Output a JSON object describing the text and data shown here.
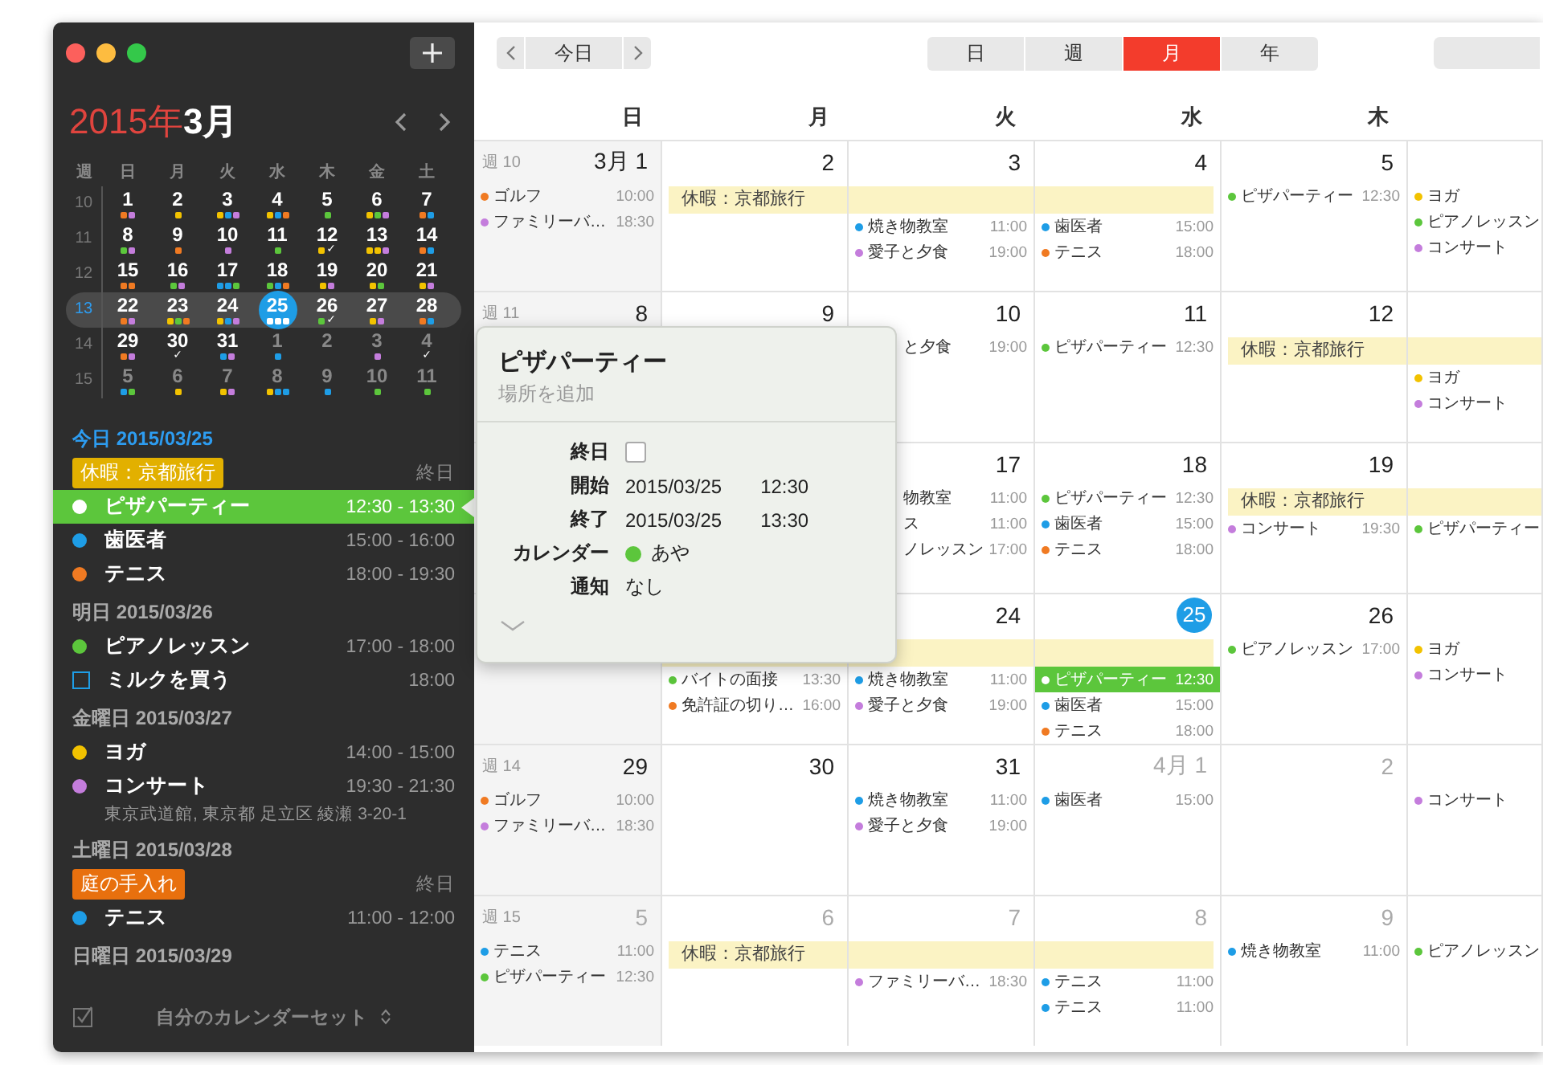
{
  "sidebar": {
    "mini": {
      "year": "2015年",
      "month": "3月",
      "weekdays": [
        "週",
        "日",
        "月",
        "火",
        "水",
        "木",
        "金",
        "土"
      ],
      "weeks": [
        {
          "week": "10",
          "current": false,
          "days": [
            {
              "n": "1",
              "other": false,
              "today": false,
              "dots": [
                {
                  "color": "#f07a22"
                },
                {
                  "color": "#c47ddc"
                }
              ]
            },
            {
              "n": "2",
              "other": false,
              "today": false,
              "dots": [
                {
                  "color": "#f2c200"
                }
              ]
            },
            {
              "n": "3",
              "other": false,
              "today": false,
              "dots": [
                {
                  "color": "#f2c200"
                },
                {
                  "color": "#1e9de6"
                },
                {
                  "color": "#c47ddc"
                }
              ]
            },
            {
              "n": "4",
              "other": false,
              "today": false,
              "dots": [
                {
                  "color": "#f2c200"
                },
                {
                  "color": "#1e9de6"
                },
                {
                  "color": "#f07a22"
                }
              ]
            },
            {
              "n": "5",
              "other": false,
              "today": false,
              "dots": [
                {
                  "color": "#5cc63c"
                }
              ]
            },
            {
              "n": "6",
              "other": false,
              "today": false,
              "dots": [
                {
                  "color": "#f2c200"
                },
                {
                  "color": "#5cc63c"
                },
                {
                  "color": "#c47ddc"
                }
              ]
            },
            {
              "n": "7",
              "other": false,
              "today": false,
              "dots": [
                {
                  "color": "#f07a22"
                },
                {
                  "color": "#1e9de6"
                }
              ]
            }
          ]
        },
        {
          "week": "11",
          "current": false,
          "days": [
            {
              "n": "8",
              "other": false,
              "today": false,
              "dots": [
                {
                  "color": "#5cc63c"
                },
                {
                  "color": "#c47ddc"
                }
              ]
            },
            {
              "n": "9",
              "other": false,
              "today": false,
              "dots": [
                {
                  "color": "#f07a22"
                }
              ]
            },
            {
              "n": "10",
              "other": false,
              "today": false,
              "dots": [
                {
                  "color": "#c47ddc"
                }
              ]
            },
            {
              "n": "11",
              "other": false,
              "today": false,
              "dots": [
                {
                  "color": "#5cc63c"
                }
              ]
            },
            {
              "n": "12",
              "other": false,
              "today": false,
              "dots": [
                {
                  "color": "#f2c200"
                }
              ],
              "mark": "✓"
            },
            {
              "n": "13",
              "other": false,
              "today": false,
              "dots": [
                {
                  "color": "#f2c200"
                },
                {
                  "color": "#f2c200"
                },
                {
                  "color": "#c47ddc"
                }
              ]
            },
            {
              "n": "14",
              "other": false,
              "today": false,
              "dots": [
                {
                  "color": "#f07a22"
                },
                {
                  "color": "#1e9de6"
                }
              ]
            }
          ]
        },
        {
          "week": "12",
          "current": false,
          "days": [
            {
              "n": "15",
              "other": false,
              "today": false,
              "dots": [
                {
                  "color": "#f07a22"
                },
                {
                  "color": "#f07a22"
                }
              ]
            },
            {
              "n": "16",
              "other": false,
              "today": false,
              "dots": [
                {
                  "color": "#5cc63c"
                },
                {
                  "color": "#c47ddc"
                }
              ]
            },
            {
              "n": "17",
              "other": false,
              "today": false,
              "dots": [
                {
                  "color": "#1e9de6"
                },
                {
                  "color": "#1e9de6"
                },
                {
                  "color": "#5cc63c"
                }
              ]
            },
            {
              "n": "18",
              "other": false,
              "today": false,
              "dots": [
                {
                  "color": "#5cc63c"
                },
                {
                  "color": "#1e9de6"
                },
                {
                  "color": "#f07a22"
                }
              ]
            },
            {
              "n": "19",
              "other": false,
              "today": false,
              "dots": [
                {
                  "color": "#f2c200"
                },
                {
                  "color": "#c47ddc"
                }
              ]
            },
            {
              "n": "20",
              "other": false,
              "today": false,
              "dots": [
                {
                  "color": "#f2c200"
                },
                {
                  "color": "#5cc63c"
                }
              ]
            },
            {
              "n": "21",
              "other": false,
              "today": false,
              "dots": [
                {
                  "color": "#f2c200"
                },
                {
                  "color": "#c47ddc"
                }
              ]
            }
          ]
        },
        {
          "week": "13",
          "current": true,
          "days": [
            {
              "n": "22",
              "other": false,
              "today": false,
              "dots": [
                {
                  "color": "#f07a22"
                },
                {
                  "color": "#c47ddc"
                }
              ]
            },
            {
              "n": "23",
              "other": false,
              "today": false,
              "dots": [
                {
                  "color": "#f2c200"
                },
                {
                  "color": "#5cc63c"
                },
                {
                  "color": "#f07a22"
                }
              ]
            },
            {
              "n": "24",
              "other": false,
              "today": false,
              "dots": [
                {
                  "color": "#f2c200"
                },
                {
                  "color": "#1e9de6"
                },
                {
                  "color": "#c47ddc"
                }
              ]
            },
            {
              "n": "25",
              "other": false,
              "today": true,
              "dots": [
                {
                  "color": "#ffffff"
                },
                {
                  "color": "#ffffff"
                },
                {
                  "color": "#ffffff"
                }
              ]
            },
            {
              "n": "26",
              "other": false,
              "today": false,
              "dots": [
                {
                  "color": "#5cc63c"
                }
              ],
              "mark": "✓"
            },
            {
              "n": "27",
              "other": false,
              "today": false,
              "dots": [
                {
                  "color": "#f2c200"
                },
                {
                  "color": "#c47ddc"
                }
              ]
            },
            {
              "n": "28",
              "other": false,
              "today": false,
              "dots": [
                {
                  "color": "#f07a22"
                },
                {
                  "color": "#1e9de6"
                }
              ]
            }
          ]
        },
        {
          "week": "14",
          "current": false,
          "days": [
            {
              "n": "29",
              "other": false,
              "today": false,
              "dots": [
                {
                  "color": "#f07a22"
                },
                {
                  "color": "#c47ddc"
                }
              ]
            },
            {
              "n": "30",
              "other": false,
              "today": false,
              "mark": "✓"
            },
            {
              "n": "31",
              "other": false,
              "today": false,
              "dots": [
                {
                  "color": "#1e9de6"
                },
                {
                  "color": "#c47ddc"
                }
              ]
            },
            {
              "n": "1",
              "other": true,
              "today": false,
              "dots": [
                {
                  "color": "#1e9de6"
                }
              ]
            },
            {
              "n": "2",
              "other": true,
              "today": false
            },
            {
              "n": "3",
              "other": true,
              "today": false,
              "dots": [
                {
                  "color": "#c47ddc"
                }
              ]
            },
            {
              "n": "4",
              "other": true,
              "today": false,
              "mark": "✓"
            }
          ]
        },
        {
          "week": "15",
          "current": false,
          "days": [
            {
              "n": "5",
              "other": true,
              "today": false,
              "dots": [
                {
                  "color": "#1e9de6"
                },
                {
                  "color": "#5cc63c"
                }
              ]
            },
            {
              "n": "6",
              "other": true,
              "today": false,
              "dots": [
                {
                  "color": "#f2c200"
                }
              ]
            },
            {
              "n": "7",
              "other": true,
              "today": false,
              "dots": [
                {
                  "color": "#f2c200"
                },
                {
                  "color": "#c47ddc"
                }
              ]
            },
            {
              "n": "8",
              "other": true,
              "today": false,
              "dots": [
                {
                  "color": "#f2c200"
                },
                {
                  "color": "#1e9de6"
                },
                {
                  "color": "#1e9de6"
                }
              ]
            },
            {
              "n": "9",
              "other": true,
              "today": false,
              "dots": [
                {
                  "color": "#1e9de6"
                }
              ]
            },
            {
              "n": "10",
              "other": true,
              "today": false,
              "dots": [
                {
                  "color": "#5cc63c"
                }
              ]
            },
            {
              "n": "11",
              "other": true,
              "today": false,
              "dots": [
                {
                  "color": "#5cc63c"
                }
              ]
            }
          ]
        }
      ]
    },
    "agenda": [
      {
        "heading": "今日 2015/03/25",
        "today": true,
        "items": [
          {
            "kind": "allday",
            "title": "休暇：京都旅行",
            "time": "終日",
            "color": "#e2b000",
            "selected": false
          },
          {
            "kind": "event",
            "title": "ピザパーティー",
            "time": "12:30 - 13:30",
            "color": "#5cc63c",
            "selected": true
          },
          {
            "kind": "event",
            "title": "歯医者",
            "time": "15:00 - 16:00",
            "color": "#1e9de6",
            "selected": false
          },
          {
            "kind": "event",
            "title": "テニス",
            "time": "18:00 - 19:30",
            "color": "#f07a22",
            "selected": false
          }
        ]
      },
      {
        "heading": "明日 2015/03/26",
        "today": false,
        "items": [
          {
            "kind": "event",
            "title": "ピアノレッスン",
            "time": "17:00 - 18:00",
            "color": "#5cc63c",
            "selected": false
          },
          {
            "kind": "task",
            "title": "ミルクを買う",
            "time": "18:00",
            "color": "#1e9de6",
            "selected": false
          }
        ]
      },
      {
        "heading": "金曜日 2015/03/27",
        "today": false,
        "items": [
          {
            "kind": "event",
            "title": "ヨガ",
            "time": "14:00 - 15:00",
            "color": "#f2c200",
            "selected": false
          },
          {
            "kind": "event",
            "title": "コンサート",
            "time": "19:30 - 21:30",
            "color": "#c47ddc",
            "selected": false,
            "location": "東京武道館, 東京都 足立区 綾瀬 3-20-1"
          }
        ]
      },
      {
        "heading": "土曜日 2015/03/28",
        "today": false,
        "items": [
          {
            "kind": "allday",
            "title": "庭の手入れ",
            "time": "終日",
            "color": "#e8700e",
            "selected": false
          },
          {
            "kind": "event",
            "title": "テニス",
            "time": "11:00 - 12:00",
            "color": "#1e9de6",
            "selected": false
          }
        ]
      },
      {
        "heading": "日曜日 2015/03/29",
        "today": false
      }
    ],
    "footer": {
      "label": "自分のカレンダーセット"
    }
  },
  "toolbar": {
    "today": "今日",
    "views": [
      {
        "label": "日",
        "selected": false
      },
      {
        "label": "週",
        "selected": false
      },
      {
        "label": "月",
        "selected": true
      },
      {
        "label": "年",
        "selected": false
      }
    ]
  },
  "calendar": {
    "weekdays": [
      "日",
      "月",
      "火",
      "水",
      "木"
    ],
    "weeks": [
      {
        "label": "週 10",
        "days": [
          {
            "date": "3月 1",
            "other": false,
            "today": false,
            "events": [
              {
                "kind": "event",
                "name": "ゴルフ",
                "time": "10:00",
                "color": "#f07a22",
                "selected": false
              },
              {
                "kind": "event",
                "name": "ファミリーバ…",
                "time": "18:30",
                "color": "#c47ddc",
                "selected": false
              }
            ]
          },
          {
            "date": "2",
            "other": false,
            "today": false,
            "allday": {
              "kind": "start",
              "title": "休暇：京都旅行"
            }
          },
          {
            "date": "3",
            "other": false,
            "today": false,
            "allday": {
              "kind": "middle"
            },
            "events": [
              {
                "kind": "event",
                "name": "焼き物教室",
                "time": "11:00",
                "color": "#1e9de6",
                "selected": false
              },
              {
                "kind": "event",
                "name": "愛子と夕食",
                "time": "19:00",
                "color": "#c47ddc",
                "selected": false
              }
            ]
          },
          {
            "date": "4",
            "other": false,
            "today": false,
            "allday": {
              "kind": "end"
            },
            "events": [
              {
                "kind": "event",
                "name": "歯医者",
                "time": "15:00",
                "color": "#1e9de6",
                "selected": false
              },
              {
                "kind": "event",
                "name": "テニス",
                "time": "18:00",
                "color": "#f07a22",
                "selected": false
              }
            ]
          },
          {
            "date": "5",
            "other": false,
            "today": false,
            "events": [
              {
                "kind": "event",
                "name": "ピザパーティー",
                "time": "12:30",
                "color": "#5cc63c",
                "selected": false
              }
            ]
          },
          {
            "events": [
              {
                "kind": "event",
                "name": "ヨガ",
                "color": "#f2c200",
                "selected": false
              },
              {
                "kind": "event",
                "name": "ピアノレッスン",
                "color": "#5cc63c",
                "selected": false
              },
              {
                "kind": "event",
                "name": "コンサート",
                "color": "#c47ddc",
                "selected": false
              }
            ]
          }
        ]
      },
      {
        "label": "週 11",
        "days": [
          {
            "date": "8",
            "other": false,
            "today": false
          },
          {
            "date": "9",
            "other": false,
            "today": false
          },
          {
            "date": "10",
            "other": false,
            "today": false,
            "events": [
              {
                "kind": "clipped",
                "name": "と夕食",
                "time": "19:00",
                "selected": false
              }
            ]
          },
          {
            "date": "11",
            "other": false,
            "today": false,
            "events": [
              {
                "kind": "event",
                "name": "ピザパーティー",
                "time": "12:30",
                "color": "#5cc63c",
                "selected": false
              }
            ]
          },
          {
            "date": "12",
            "other": false,
            "today": false,
            "allday": {
              "kind": "start",
              "title": "休暇：京都旅行"
            }
          },
          {
            "allday": {
              "kind": "middle"
            },
            "events": [
              {
                "kind": "event",
                "name": "ヨガ",
                "color": "#f2c200",
                "selected": false
              },
              {
                "kind": "event",
                "name": "コンサート",
                "color": "#c47ddc",
                "selected": false
              }
            ]
          }
        ]
      },
      {
        "days": [
          {
            "date": "17",
            "other": false,
            "today": false,
            "events": [
              {
                "kind": "clipped",
                "name": "物教室",
                "time": "11:00",
                "selected": false
              },
              {
                "kind": "clipped",
                "name": "ス",
                "time": "11:00",
                "selected": false
              },
              {
                "kind": "clipped",
                "name": "ノレッスン",
                "time": "17:00",
                "selected": false
              }
            ]
          },
          {
            "date": "18",
            "other": false,
            "today": false,
            "events": [
              {
                "kind": "event",
                "name": "ピザパーティー",
                "time": "12:30",
                "color": "#5cc63c",
                "selected": false
              },
              {
                "kind": "event",
                "name": "歯医者",
                "time": "15:00",
                "color": "#1e9de6",
                "selected": false
              },
              {
                "kind": "event",
                "name": "テニス",
                "time": "18:00",
                "color": "#f07a22",
                "selected": false
              }
            ]
          },
          {
            "date": "19",
            "other": false,
            "today": false,
            "allday": {
              "kind": "start",
              "title": "休暇：京都旅行"
            },
            "events": [
              {
                "kind": "event",
                "name": "コンサート",
                "time": "19:30",
                "color": "#c47ddc",
                "selected": false
              }
            ]
          },
          {
            "allday": {
              "kind": "middle"
            },
            "events": [
              {
                "kind": "event",
                "name": "ピザパーティー",
                "color": "#5cc63c",
                "selected": false
              }
            ]
          }
        ]
      },
      {
        "days": [
          {
            "allday": {
              "kind": "middle"
            },
            "events": [
              {
                "kind": "event",
                "name": "バイトの面接",
                "time": "13:30",
                "color": "#5cc63c",
                "selected": false
              },
              {
                "kind": "event",
                "name": "免許証の切り…",
                "time": "16:00",
                "color": "#f07a22",
                "selected": false
              }
            ]
          },
          {
            "date": "24",
            "other": false,
            "today": false,
            "allday": {
              "kind": "middle"
            },
            "events": [
              {
                "kind": "event",
                "name": "焼き物教室",
                "time": "11:00",
                "color": "#1e9de6",
                "selected": false
              },
              {
                "kind": "event",
                "name": "愛子と夕食",
                "time": "19:00",
                "color": "#c47ddc",
                "selected": false
              }
            ]
          },
          {
            "date": "25",
            "other": false,
            "today": true,
            "allday": {
              "kind": "end"
            },
            "events": [
              {
                "kind": "event",
                "name": "ピザパーティー",
                "time": "12:30",
                "color": "#5cc63c",
                "selected": true
              },
              {
                "kind": "event",
                "name": "歯医者",
                "time": "15:00",
                "color": "#1e9de6",
                "selected": false
              },
              {
                "kind": "event",
                "name": "テニス",
                "time": "18:00",
                "color": "#f07a22",
                "selected": false
              }
            ]
          },
          {
            "date": "26",
            "other": false,
            "today": false,
            "events": [
              {
                "kind": "event",
                "name": "ピアノレッスン",
                "time": "17:00",
                "color": "#5cc63c",
                "selected": false
              }
            ]
          },
          {
            "events": [
              {
                "kind": "event",
                "name": "ヨガ",
                "color": "#f2c200",
                "selected": false
              },
              {
                "kind": "event",
                "name": "コンサート",
                "color": "#c47ddc",
                "selected": false
              }
            ]
          }
        ]
      },
      {
        "label": "週 14",
        "days": [
          {
            "date": "29",
            "other": false,
            "today": false,
            "events": [
              {
                "kind": "event",
                "name": "ゴルフ",
                "time": "10:00",
                "color": "#f07a22",
                "selected": false
              },
              {
                "kind": "event",
                "name": "ファミリーバ…",
                "time": "18:30",
                "color": "#c47ddc",
                "selected": false
              }
            ]
          },
          {
            "date": "30",
            "other": false,
            "today": false
          },
          {
            "date": "31",
            "other": false,
            "today": false,
            "events": [
              {
                "kind": "event",
                "name": "焼き物教室",
                "time": "11:00",
                "color": "#1e9de6",
                "selected": false
              },
              {
                "kind": "event",
                "name": "愛子と夕食",
                "time": "19:00",
                "color": "#c47ddc",
                "selected": false
              }
            ]
          },
          {
            "date": "4月 1",
            "other": true,
            "today": false,
            "events": [
              {
                "kind": "event",
                "name": "歯医者",
                "time": "15:00",
                "color": "#1e9de6",
                "selected": false
              }
            ]
          },
          {
            "date": "2",
            "other": true,
            "today": false
          },
          {
            "events": [
              {
                "kind": "event",
                "name": "コンサート",
                "color": "#c47ddc",
                "selected": false
              }
            ]
          }
        ]
      },
      {
        "label": "週 15",
        "days": [
          {
            "date": "5",
            "other": true,
            "today": false,
            "events": [
              {
                "kind": "event",
                "name": "テニス",
                "time": "11:00",
                "color": "#1e9de6",
                "selected": false
              },
              {
                "kind": "event",
                "name": "ピザパーティー",
                "time": "12:30",
                "color": "#5cc63c",
                "selected": false
              }
            ]
          },
          {
            "date": "6",
            "other": true,
            "today": false,
            "allday": {
              "kind": "start",
              "title": "休暇：京都旅行"
            }
          },
          {
            "date": "7",
            "other": true,
            "today": false,
            "allday": {
              "kind": "middle"
            },
            "events": [
              {
                "kind": "event",
                "name": "ファミリーバ…",
                "time": "18:30",
                "color": "#c47ddc",
                "selected": false
              }
            ]
          },
          {
            "date": "8",
            "other": true,
            "today": false,
            "allday": {
              "kind": "end"
            },
            "events": [
              {
                "kind": "event",
                "name": "テニス",
                "time": "11:00",
                "color": "#1e9de6",
                "selected": false
              },
              {
                "kind": "event",
                "name": "テニス",
                "time": "11:00",
                "color": "#1e9de6",
                "selected": false
              }
            ]
          },
          {
            "date": "9",
            "other": true,
            "today": false,
            "events": [
              {
                "kind": "event",
                "name": "焼き物教室",
                "time": "11:00",
                "color": "#1e9de6",
                "selected": false
              }
            ]
          },
          {
            "events": [
              {
                "kind": "event",
                "name": "ピアノレッスン",
                "color": "#5cc63c",
                "selected": false
              }
            ]
          }
        ]
      }
    ]
  },
  "popover": {
    "title": "ピザパーティー",
    "location_placeholder": "場所を追加",
    "rows": [
      {
        "kind": "checkbox",
        "label": "終日",
        "checked": false
      },
      {
        "kind": "datetime",
        "label": "開始",
        "date": "2015/03/25",
        "time": "12:30"
      },
      {
        "kind": "datetime",
        "label": "終了",
        "date": "2015/03/25",
        "time": "13:30"
      },
      {
        "kind": "calendar",
        "label": "カレンダー",
        "value": "あや",
        "color": "#5cc63c"
      },
      {
        "kind": "text",
        "label": "通知",
        "value": "なし"
      }
    ]
  }
}
